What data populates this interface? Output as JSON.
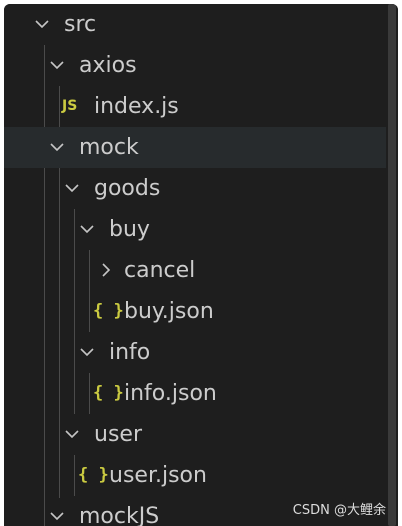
{
  "tree": {
    "src": "src",
    "axios": "axios",
    "index_js": "index.js",
    "mock": "mock",
    "goods": "goods",
    "buy": "buy",
    "cancel": "cancel",
    "buy_json": "buy.json",
    "info": "info",
    "info_json": "info.json",
    "user": "user",
    "user_json": "user.json",
    "mockjs": "mockJS"
  },
  "icons": {
    "js_glyph": "JS",
    "json_glyph": "{ }",
    "js_color": "#cbcb41",
    "json_color": "#cbcb41"
  },
  "watermark": "CSDN @大鲤余",
  "colors": {
    "background": "#1e1e1e",
    "text": "#cccccc",
    "highlight_row": "#272b2d"
  }
}
